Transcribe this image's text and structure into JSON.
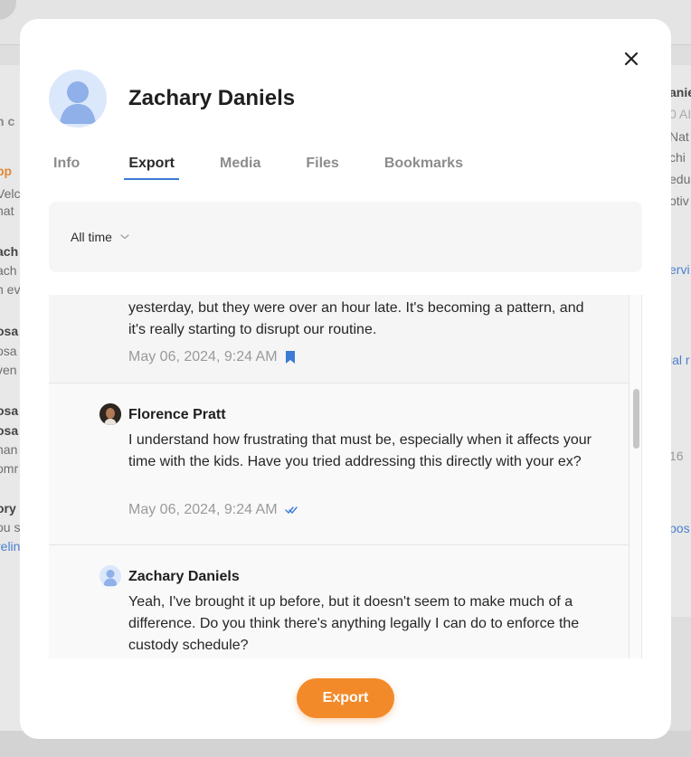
{
  "background": {
    "left_snippets": [
      "h c",
      "pp",
      "Velc",
      "hat",
      "ach",
      "ach",
      "n ev",
      "osa",
      "osa",
      "ven",
      "osa",
      "osa",
      "han",
      "omr",
      "ory",
      "ou s",
      "relin"
    ],
    "right_snippets": [
      "anie",
      "0 AI",
      "Nat",
      "chi",
      "edu",
      "otiv",
      "ervi",
      "ial r",
      "16",
      "pos"
    ]
  },
  "contact": {
    "name": "Zachary Daniels"
  },
  "tabs": [
    {
      "label": "Info",
      "active": false
    },
    {
      "label": "Export",
      "active": true
    },
    {
      "label": "Media",
      "active": false
    },
    {
      "label": "Files",
      "active": false
    },
    {
      "label": "Bookmarks",
      "active": false
    }
  ],
  "filter": {
    "range_label": "All time"
  },
  "messages": [
    {
      "sender": "",
      "text": "yesterday, but they were over an hour late. It's becoming a pattern, and it's really starting to disrupt our routine.",
      "time": "May 06, 2024, 9:24 AM",
      "icon": "bookmark-icon"
    },
    {
      "sender": "Florence Pratt",
      "text": "I understand how frustrating that must be, especially when it affects your time with the kids. Have you tried addressing this directly with your ex?",
      "time": "May 06, 2024, 9:24 AM",
      "icon": "check-icon"
    },
    {
      "sender": "Zachary Daniels",
      "text": "Yeah, I've brought it up before, but it doesn't seem to make much of a difference. Do you think there's anything legally I can do to enforce the custody schedule?",
      "time": "",
      "icon": ""
    }
  ],
  "actions": {
    "export_label": "Export"
  },
  "colors": {
    "accent_blue": "#3a7bd5",
    "export_orange": "#f28a2a",
    "bookmark_blue": "#3a7bd5"
  }
}
